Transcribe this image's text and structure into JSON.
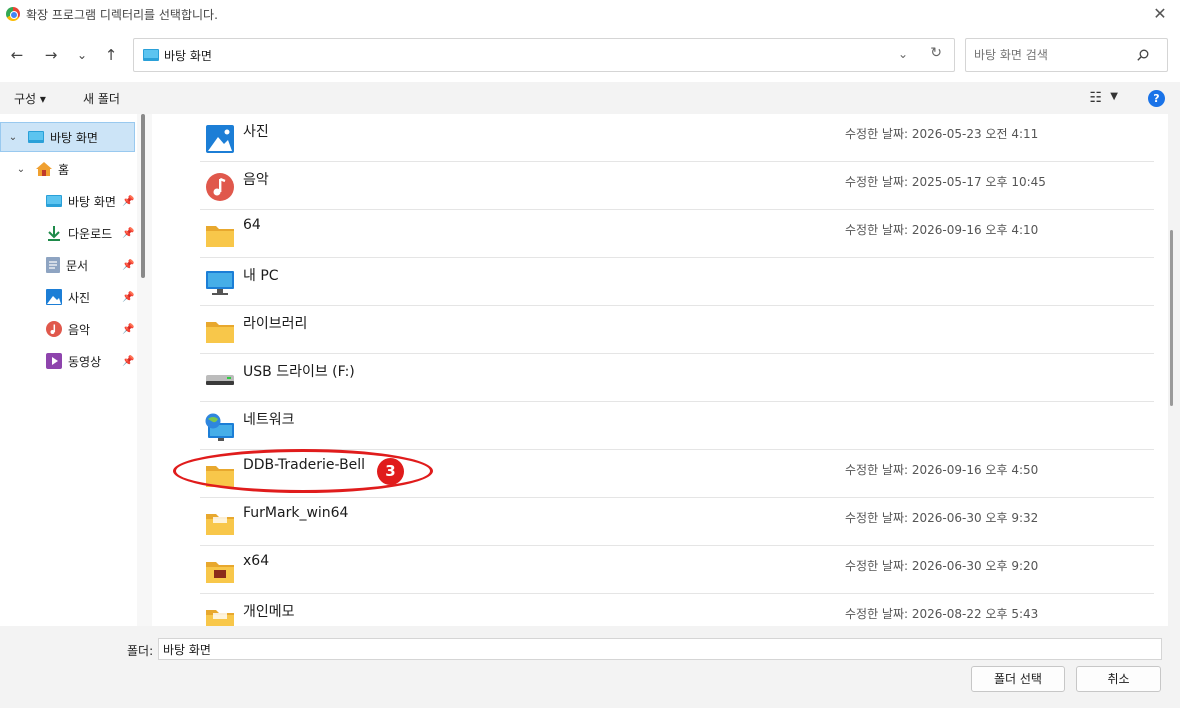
{
  "window": {
    "title": "확장 프로그램 디렉터리를 선택합니다.",
    "close_glyph": "✕"
  },
  "nav": {
    "back_glyph": "←",
    "forward_glyph": "→",
    "recent_glyph": "⌄",
    "up_glyph": "↑",
    "address_text": "바탕 화면",
    "address_drop_glyph": "⌄",
    "refresh_glyph": "↻",
    "search_placeholder": "바탕 화면 검색"
  },
  "toolbar": {
    "organize": "구성 ▾",
    "new_folder": "새 폴더",
    "view_glyph": "☷",
    "view_drop_glyph": "▼",
    "help_glyph": "?"
  },
  "sidebar": {
    "desktop_root": "바탕 화면",
    "home": "홈",
    "items": [
      {
        "label": "바탕 화면",
        "icon": "desktop-icon"
      },
      {
        "label": "다운로드",
        "icon": "download-icon"
      },
      {
        "label": "문서",
        "icon": "document-icon"
      },
      {
        "label": "사진",
        "icon": "pictures-icon"
      },
      {
        "label": "음악",
        "icon": "music-icon"
      },
      {
        "label": "동영상",
        "icon": "video-icon"
      }
    ]
  },
  "files": {
    "date_prefix": "수정한 날짜:",
    "rows": [
      {
        "name": "사진",
        "icon": "pictures-icon",
        "date": "수정한 날짜: 2026-05-23 오전 4:11"
      },
      {
        "name": "음악",
        "icon": "music-icon",
        "date": "수정한 날짜: 2025-05-17 오후 10:45"
      },
      {
        "name": "64",
        "icon": "folder-icon",
        "date": "수정한 날짜: 2026-09-16 오후 4:10"
      },
      {
        "name": "내 PC",
        "icon": "pc-icon",
        "date": ""
      },
      {
        "name": "라이브러리",
        "icon": "folder-icon",
        "date": ""
      },
      {
        "name": "USB 드라이브 (F:)",
        "icon": "usb-drive-icon",
        "date": ""
      },
      {
        "name": "네트워크",
        "icon": "network-icon",
        "date": ""
      },
      {
        "name": "DDB-Traderie-Bell",
        "icon": "folder-icon",
        "date": "수정한 날짜: 2026-09-16 오후 4:50"
      },
      {
        "name": "FurMark_win64",
        "icon": "folder-icon",
        "date": "수정한 날짜: 2026-06-30 오후 9:32"
      },
      {
        "name": "x64",
        "icon": "folder-icon",
        "date": "수정한 날짜: 2026-06-30 오후 9:20"
      },
      {
        "name": "개인메모",
        "icon": "folder-icon",
        "date": "수정한 날짜: 2026-08-22 오후 5:43"
      }
    ]
  },
  "annotation": {
    "badge": "3",
    "color": "#e01c1c"
  },
  "footer": {
    "folder_label": "폴더:",
    "folder_value": "바탕 화면",
    "select_button": "폴더 선택",
    "cancel_button": "취소"
  },
  "colors": {
    "accent": "#1a73e8",
    "selection": "#cce4f7",
    "folder": "#f8c74a"
  }
}
